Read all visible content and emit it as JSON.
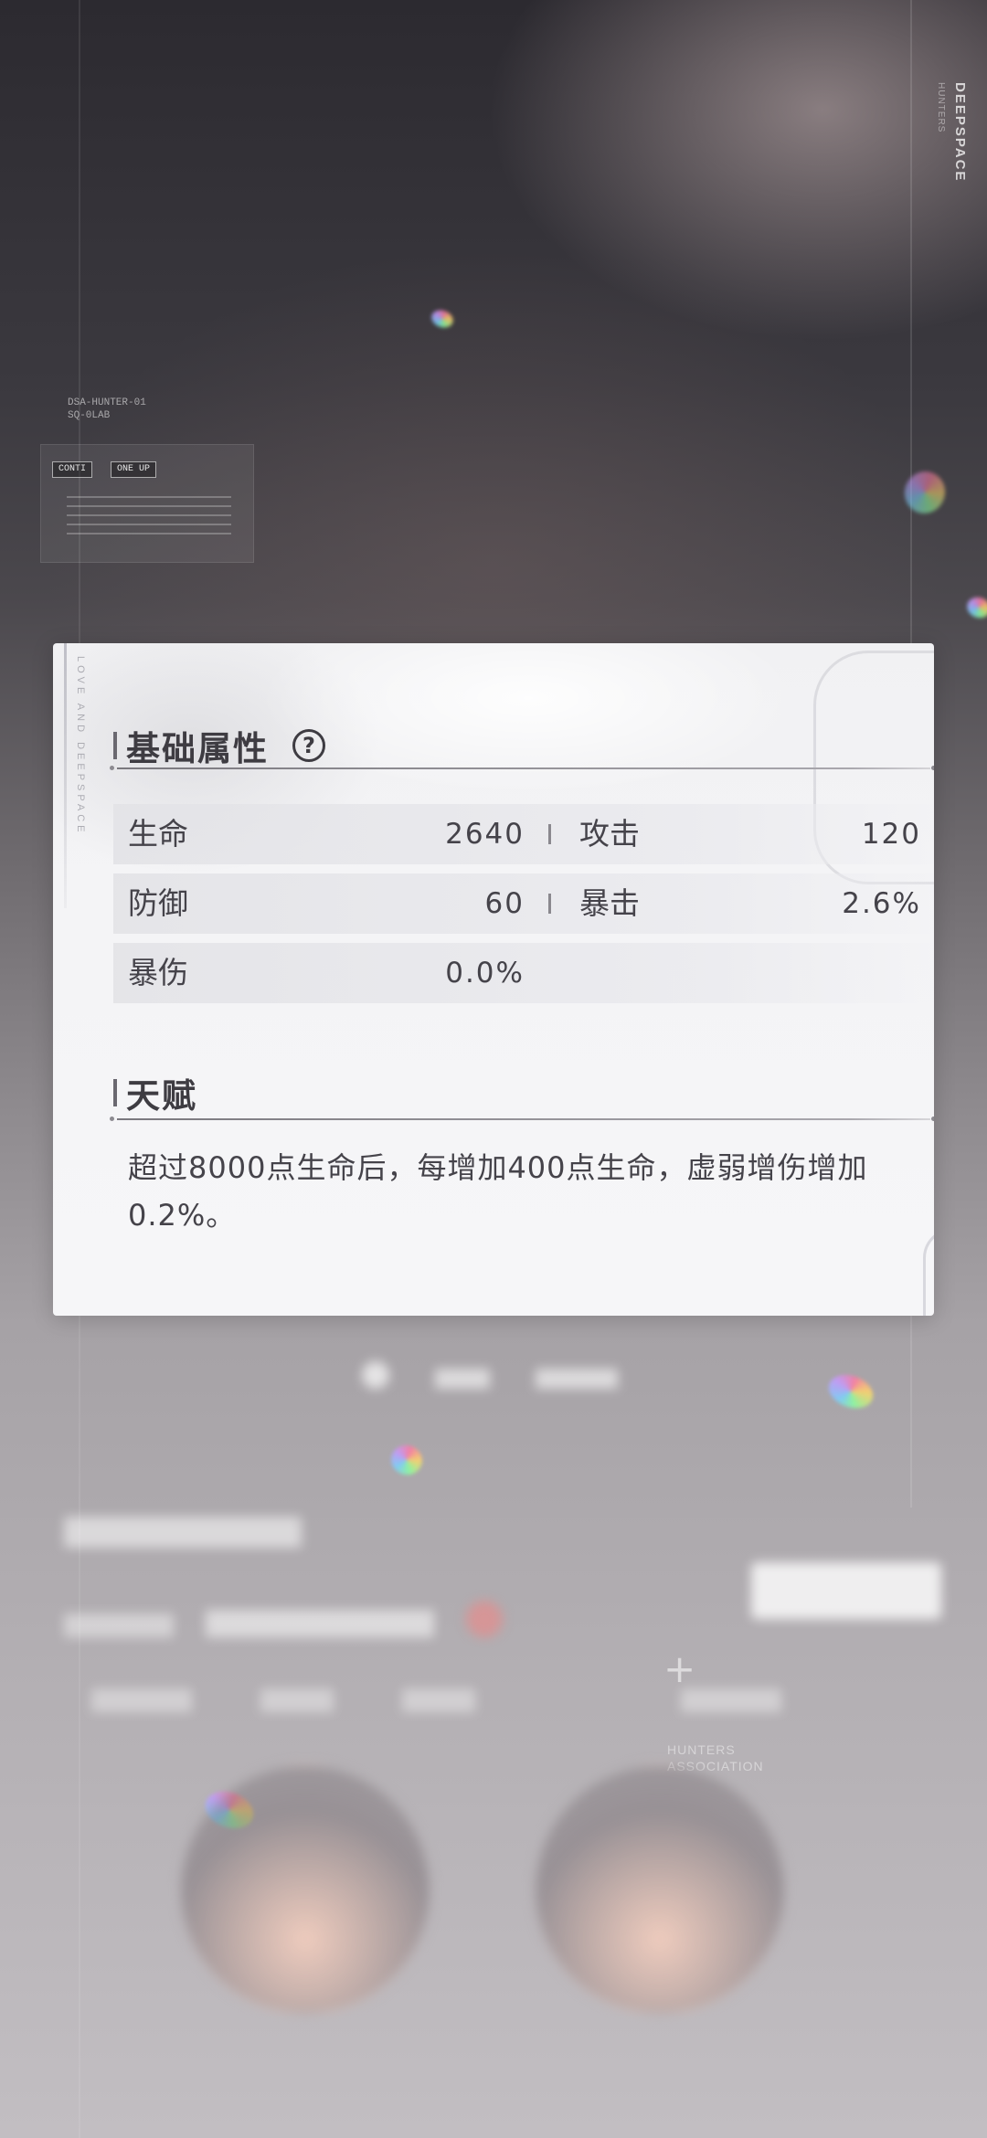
{
  "branding": {
    "vertical_title": "DEEPSPACE",
    "vertical_sub": "HUNTERS",
    "card_side_text": "LOVE AND DEEPSPACE"
  },
  "hud": {
    "tiny_line_1": "DSA-HUNTER-01",
    "tiny_line_2": "SQ-0LAB",
    "chip_1": "CONTI",
    "chip_2": "ONE UP"
  },
  "card": {
    "base_section": {
      "title": "基础属性",
      "help_icon": "help-icon",
      "help_glyph": "?",
      "stats": [
        {
          "label": "生命",
          "value": "2640"
        },
        {
          "label": "攻击",
          "value": "120"
        },
        {
          "label": "防御",
          "value": "60"
        },
        {
          "label": "暴击",
          "value": "2.6%"
        },
        {
          "label": "暴伤",
          "value": "0.0%"
        }
      ]
    },
    "talent_section": {
      "title": "天赋",
      "description": "超过8000点生命后，每增加400点生命，虚弱增伤增加0.2%。"
    }
  },
  "background_ui": {
    "plus_glyph": "+",
    "assoc_line_1": "HUNTERS",
    "assoc_line_2": "ASSOCIATION"
  },
  "colors": {
    "card_bg": "#f4f4f6",
    "text_dark": "#45434a",
    "title_dark": "#3e3c42",
    "row_bg": "#e4e4e8"
  }
}
